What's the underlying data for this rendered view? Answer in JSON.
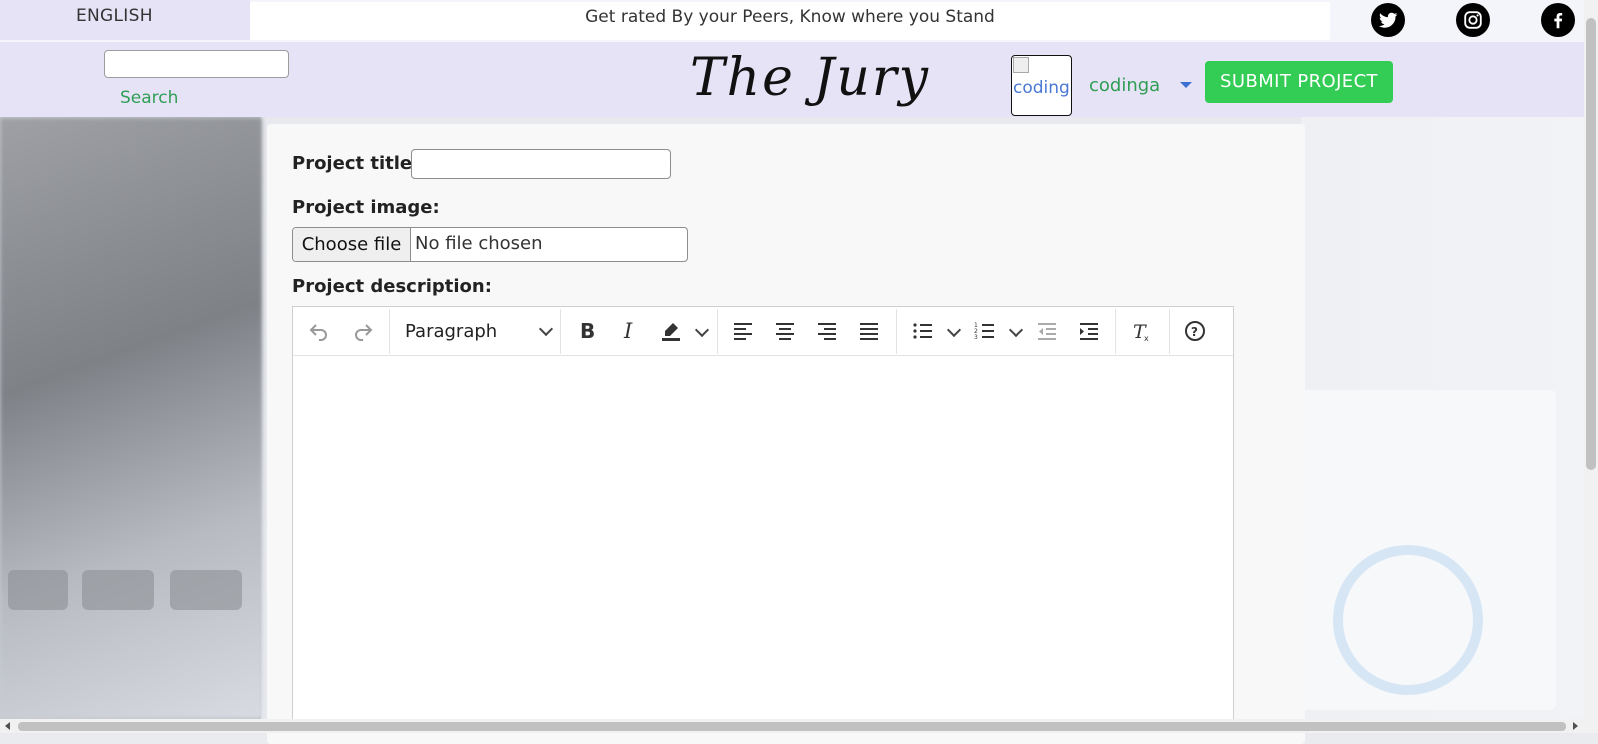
{
  "topbar": {
    "language": "ENGLISH",
    "tagline": "Get rated By your Peers, Know where you Stand",
    "social": [
      "twitter-icon",
      "instagram-icon",
      "facebook-icon"
    ]
  },
  "header": {
    "search_placeholder": "",
    "search_label": "Search",
    "brand": "The Jury",
    "avatar_alt": "codinga's photo",
    "username": "codinga",
    "submit_label": "SUBMIT PROJECT"
  },
  "form": {
    "title_label": "Project title:",
    "title_value": "",
    "image_label": "Project image:",
    "file_button": "Choose file",
    "file_status": "No file chosen",
    "description_label": "Project description:"
  },
  "editor": {
    "paragraph_format": "Paragraph",
    "toolbar": [
      "undo-icon",
      "redo-icon",
      "bold-icon",
      "italic-icon",
      "highlight-icon",
      "align-left-icon",
      "align-center-icon",
      "align-right-icon",
      "align-justify-icon",
      "bulleted-list-icon",
      "numbered-list-icon",
      "outdent-icon",
      "indent-icon",
      "remove-format-icon",
      "help-icon"
    ],
    "content": ""
  },
  "colors": {
    "accent_green": "#33cc55",
    "link_green": "#2f9e54",
    "header_bg": "#e6e3f7"
  }
}
